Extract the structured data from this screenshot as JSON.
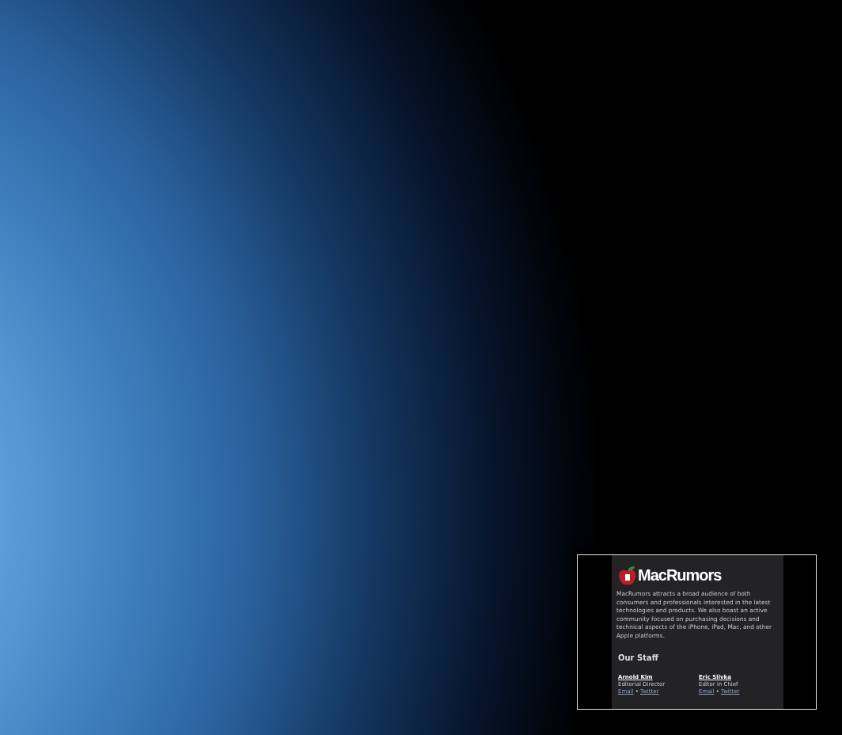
{
  "window": {
    "logo_text": "MacRumors",
    "about": "MacRumors attracts a broad audience of both consumers and professionals interested in the latest technologies and products. We also boast an active community focused on purchasing decisions and technical aspects of the iPhone, iPad, Mac, and other Apple platforms.",
    "staff_heading": "Our Staff",
    "staff": [
      {
        "name": "Arnold Kim",
        "role": "Editorial Director",
        "links": [
          "Email",
          "Twitter"
        ],
        "separator": "•"
      },
      {
        "name": "Eric Slivka",
        "role": "Editor in Chief",
        "links": [
          "Email",
          "Twitter"
        ],
        "separator": "•"
      }
    ]
  }
}
